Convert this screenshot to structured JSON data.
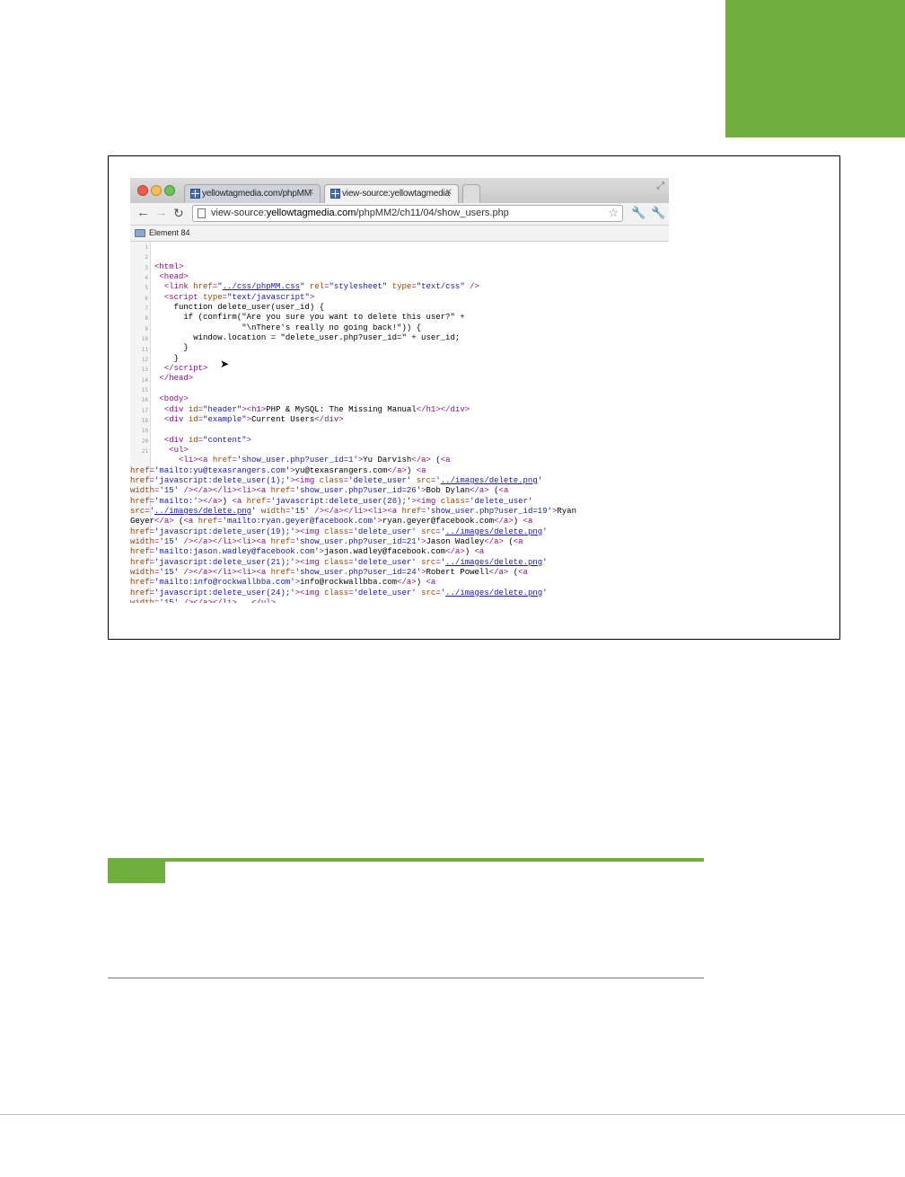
{
  "browser": {
    "tabs": [
      {
        "label": "yellowtagmedia.com/phpMM"
      },
      {
        "label": "view-source:yellowtagmedia"
      }
    ],
    "url_scheme": "view-source:",
    "url_host": "yellowtagmedia.com",
    "url_path": "/phpMM2/ch11/04/show_users.php",
    "bookmark_label": "Element 84"
  },
  "source": {
    "line_numbers": [
      "1",
      "2",
      "3",
      "4",
      "5",
      "6",
      "7",
      "8",
      "9",
      "10",
      "11",
      "12",
      "13",
      "14",
      "15",
      "16",
      "17",
      "18",
      "19",
      "20",
      "21"
    ]
  },
  "colors": {
    "accent": "#6fae3f"
  }
}
